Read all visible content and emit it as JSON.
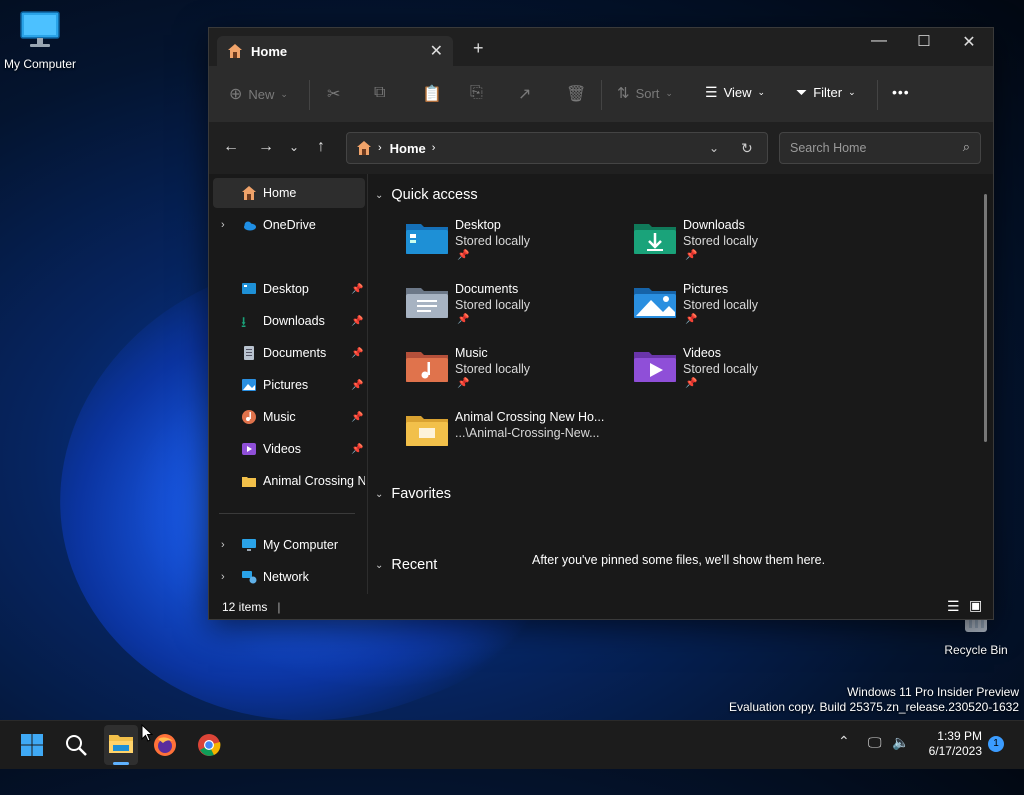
{
  "desktop": {
    "icons": [
      {
        "label": "My Computer",
        "icon": "monitor-icon"
      },
      {
        "label": "Recycle Bin",
        "icon": "recycle-bin-icon"
      }
    ],
    "watermark_line1": "Windows 11 Pro Insider Preview",
    "watermark_line2": "Evaluation copy. Build 25375.zn_release.230520-1632"
  },
  "window": {
    "tab_title": "Home",
    "toolbar": {
      "new_label": "New",
      "sort_label": "Sort",
      "view_label": "View",
      "filter_label": "Filter",
      "more_label": "•••"
    },
    "address": {
      "path": "Home"
    },
    "search": {
      "placeholder": "Search Home"
    },
    "nav": {
      "items": [
        {
          "label": "Home",
          "icon": "home-icon",
          "selected": true
        },
        {
          "label": "OneDrive",
          "icon": "cloud-icon",
          "expandable": true
        },
        {
          "label": "Desktop",
          "icon": "desktop-folder-icon",
          "pinned": true
        },
        {
          "label": "Downloads",
          "icon": "download-icon",
          "pinned": true
        },
        {
          "label": "Documents",
          "icon": "document-icon",
          "pinned": true
        },
        {
          "label": "Pictures",
          "icon": "pictures-icon",
          "pinned": true
        },
        {
          "label": "Music",
          "icon": "music-icon",
          "pinned": true
        },
        {
          "label": "Videos",
          "icon": "video-icon",
          "pinned": true
        },
        {
          "label": "Animal Crossing New Horizons",
          "icon": "folder-icon"
        },
        {
          "label": "My Computer",
          "icon": "monitor-icon",
          "expandable": true
        },
        {
          "label": "Network",
          "icon": "network-icon",
          "expandable": true
        }
      ]
    },
    "content": {
      "quick_access_heading": "Quick access",
      "favorites_heading": "Favorites",
      "recent_heading": "Recent",
      "favorites_empty": "After you've pinned some files, we'll show them here.",
      "quick_access": [
        {
          "name": "Desktop",
          "sub": "Stored locally",
          "icon": "desktop-folder-icon",
          "color": "#1e90d6"
        },
        {
          "name": "Downloads",
          "sub": "Stored locally",
          "icon": "downloads-folder-icon",
          "color": "#1aa37a"
        },
        {
          "name": "Documents",
          "sub": "Stored locally",
          "icon": "documents-folder-icon",
          "color": "#8a97a8"
        },
        {
          "name": "Pictures",
          "sub": "Stored locally",
          "icon": "pictures-folder-icon",
          "color": "#2a8fe0"
        },
        {
          "name": "Music",
          "sub": "Stored locally",
          "icon": "music-folder-icon",
          "color": "#e0734c"
        },
        {
          "name": "Videos",
          "sub": "Stored locally",
          "icon": "videos-folder-icon",
          "color": "#8f4fd8"
        },
        {
          "name": "Animal Crossing New Ho...",
          "sub": "...\\Animal-Crossing-New...",
          "icon": "folder-icon",
          "color": "#f2c04a"
        }
      ]
    },
    "status": {
      "items_count": "12 items"
    }
  },
  "taskbar": {
    "time": "1:39 PM",
    "date": "6/17/2023",
    "notification_count": "1"
  }
}
